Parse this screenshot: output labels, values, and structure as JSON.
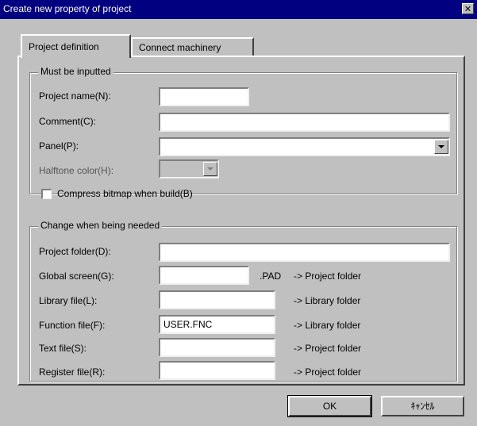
{
  "window": {
    "title": "Create new property of project",
    "close_glyph": "✕"
  },
  "tabs": [
    "Project definition",
    "Connect machinery"
  ],
  "must": {
    "legend": "Must be inputted",
    "project_name": {
      "label": "Project name(N):",
      "value": ""
    },
    "comment": {
      "label": "Comment(C):",
      "value": ""
    },
    "panel": {
      "label": "Panel(P):",
      "value": ""
    },
    "halftone": {
      "label": "Halftone color(H):",
      "value": ""
    },
    "compress": {
      "label": "Compress bitmap when build(B)",
      "checked": false
    }
  },
  "change": {
    "legend": "Change when being needed",
    "project_folder": {
      "label": "Project folder(D):",
      "value": ""
    },
    "global_screen": {
      "label": "Global screen(G):",
      "value": "",
      "ext": ".PAD",
      "suffix": "-> Project folder"
    },
    "library_file": {
      "label": "Library file(L):",
      "value": "",
      "suffix": "-> Library folder"
    },
    "function_file": {
      "label": "Function file(F):",
      "value": "USER.FNC",
      "suffix": "-> Library folder"
    },
    "text_file": {
      "label": "Text file(S):",
      "value": "",
      "suffix": "-> Project folder"
    },
    "register_file": {
      "label": "Register file(R):",
      "value": "",
      "suffix": "-> Project folder"
    }
  },
  "buttons": {
    "ok": "OK",
    "cancel": "ｷｬﾝｾﾙ"
  }
}
